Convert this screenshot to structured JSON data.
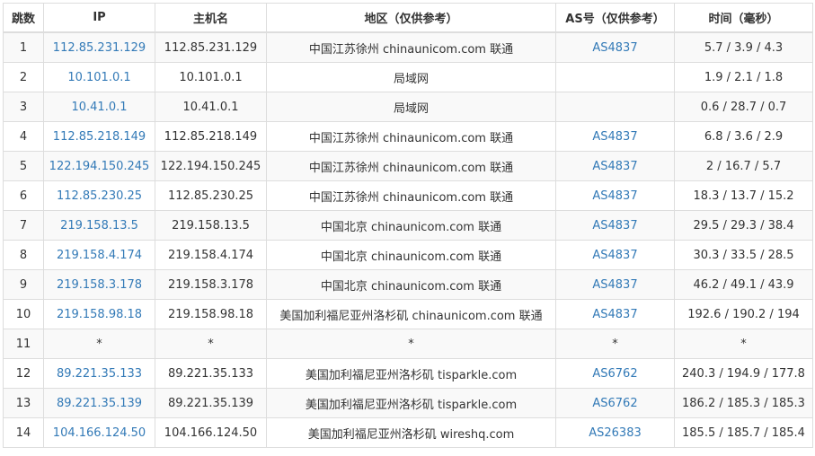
{
  "columns": [
    "跳数",
    "IP",
    "主机名",
    "地区（仅供参考）",
    "AS号（仅供参考）",
    "时间（毫秒）"
  ],
  "rows": [
    {
      "hop": "1",
      "ip": "112.85.231.129",
      "host": "112.85.231.129",
      "region": "中国江苏徐州 chinaunicom.com 联通",
      "asn": "AS4837",
      "time": "5.7 / 3.9 / 4.3"
    },
    {
      "hop": "2",
      "ip": "10.101.0.1",
      "host": "10.101.0.1",
      "region": "局域网",
      "asn": "",
      "time": "1.9 / 2.1 / 1.8"
    },
    {
      "hop": "3",
      "ip": "10.41.0.1",
      "host": "10.41.0.1",
      "region": "局域网",
      "asn": "",
      "time": "0.6 / 28.7 / 0.7"
    },
    {
      "hop": "4",
      "ip": "112.85.218.149",
      "host": "112.85.218.149",
      "region": "中国江苏徐州 chinaunicom.com 联通",
      "asn": "AS4837",
      "time": "6.8 / 3.6 / 2.9"
    },
    {
      "hop": "5",
      "ip": "122.194.150.245",
      "host": "122.194.150.245",
      "region": "中国江苏徐州 chinaunicom.com 联通",
      "asn": "AS4837",
      "time": "2 / 16.7 / 5.7"
    },
    {
      "hop": "6",
      "ip": "112.85.230.25",
      "host": "112.85.230.25",
      "region": "中国江苏徐州 chinaunicom.com 联通",
      "asn": "AS4837",
      "time": "18.3 / 13.7 / 15.2"
    },
    {
      "hop": "7",
      "ip": "219.158.13.5",
      "host": "219.158.13.5",
      "region": "中国北京 chinaunicom.com 联通",
      "asn": "AS4837",
      "time": "29.5 / 29.3 / 38.4"
    },
    {
      "hop": "8",
      "ip": "219.158.4.174",
      "host": "219.158.4.174",
      "region": "中国北京 chinaunicom.com 联通",
      "asn": "AS4837",
      "time": "30.3 / 33.5 / 28.5"
    },
    {
      "hop": "9",
      "ip": "219.158.3.178",
      "host": "219.158.3.178",
      "region": "中国北京 chinaunicom.com 联通",
      "asn": "AS4837",
      "time": "46.2 / 49.1 / 43.9"
    },
    {
      "hop": "10",
      "ip": "219.158.98.18",
      "host": "219.158.98.18",
      "region": "美国加利福尼亚州洛杉矶 chinaunicom.com 联通",
      "asn": "AS4837",
      "time": "192.6 / 190.2 / 194"
    },
    {
      "hop": "11",
      "ip": "*",
      "host": "*",
      "region": "*",
      "asn": "*",
      "time": "*"
    },
    {
      "hop": "12",
      "ip": "89.221.35.133",
      "host": "89.221.35.133",
      "region": "美国加利福尼亚州洛杉矶 tisparkle.com",
      "asn": "AS6762",
      "time": "240.3 / 194.9 / 177.8"
    },
    {
      "hop": "13",
      "ip": "89.221.35.139",
      "host": "89.221.35.139",
      "region": "美国加利福尼亚州洛杉矶 tisparkle.com",
      "asn": "AS6762",
      "time": "186.2 / 185.3 / 185.3"
    },
    {
      "hop": "14",
      "ip": "104.166.124.50",
      "host": "104.166.124.50",
      "region": "美国加利福尼亚州洛杉矶 wireshq.com",
      "asn": "AS26383",
      "time": "185.5 / 185.7 / 185.4"
    }
  ],
  "colors": {
    "link": "#337ab7",
    "text": "#333333",
    "border": "#dddddd",
    "stripe": "#f9f9f9"
  }
}
